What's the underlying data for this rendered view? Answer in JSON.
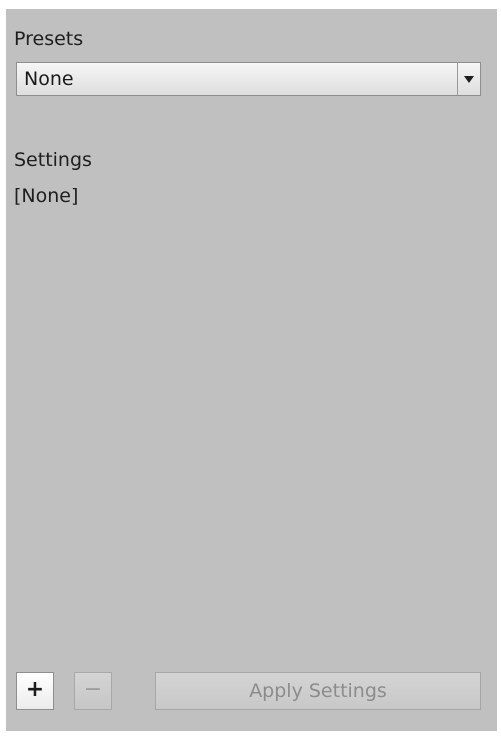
{
  "presets": {
    "label": "Presets",
    "selected": "None"
  },
  "settings": {
    "label": "Settings",
    "value": "[None]"
  },
  "footer": {
    "add_label": "+",
    "remove_label": "−",
    "apply_label": "Apply Settings"
  },
  "icons": {
    "dropdown": "chevron-down-icon"
  },
  "colors": {
    "panel_background": "#c0c0c0",
    "disabled_text": "#8c8c8c"
  }
}
